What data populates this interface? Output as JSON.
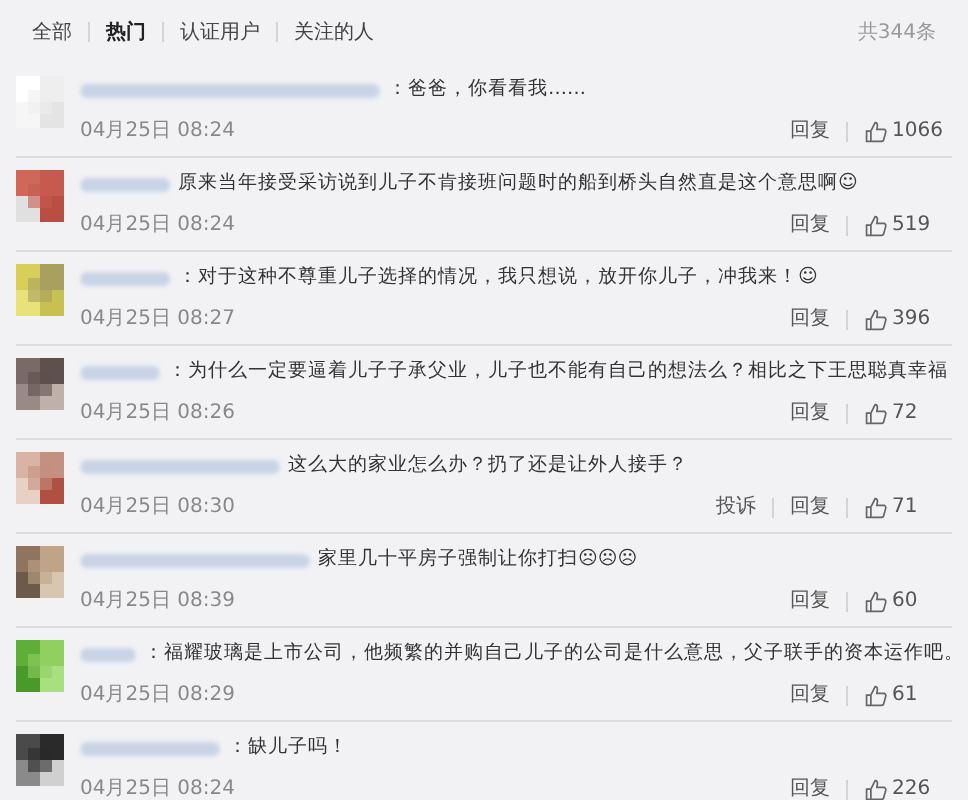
{
  "tabs": [
    {
      "label": "全部",
      "selected": false
    },
    {
      "label": "热门",
      "selected": true
    },
    {
      "label": "认证用户",
      "selected": false
    },
    {
      "label": "关注的人",
      "selected": false
    }
  ],
  "total": "共344条",
  "comments": [
    {
      "text": "：爸爸，你看看我……",
      "time": "04月25日 08:24",
      "actions": [
        "回复"
      ],
      "likes": "1066"
    },
    {
      "text": "原来当年接受采访说到儿子不肯接班问题时的船到桥头自然直是这个意思啊☺",
      "time": "04月25日 08:24",
      "actions": [
        "回复"
      ],
      "likes": "519"
    },
    {
      "text": "：对于这种不尊重儿子选择的情况，我只想说，放开你儿子，冲我来！☺",
      "time": "04月25日 08:27",
      "actions": [
        "回复"
      ],
      "likes": "396"
    },
    {
      "text": "：为什么一定要逼着儿子子承父业，儿子也不能有自己的想法么？相比之下王思聪真幸福",
      "time": "04月25日 08:26",
      "actions": [
        "回复"
      ],
      "likes": "72"
    },
    {
      "text": "这么大的家业怎么办？扔了还是让外人接手？",
      "time": "04月25日 08:30",
      "actions": [
        "投诉",
        "回复"
      ],
      "likes": "71"
    },
    {
      "text": "家里几十平房子强制让你打扫☹☹☹",
      "time": "04月25日 08:39",
      "actions": [
        "回复"
      ],
      "likes": "60"
    },
    {
      "text": "：福耀玻璃是上市公司，他频繁的并购自己儿子的公司是什么意思，父子联手的资本运作吧。",
      "time": "04月25日 08:29",
      "actions": [
        "回复"
      ],
      "likes": "61"
    },
    {
      "text": "：缺儿子吗！",
      "time": "04月25日 08:24",
      "actions": [
        "回复"
      ],
      "likes": "226"
    }
  ]
}
